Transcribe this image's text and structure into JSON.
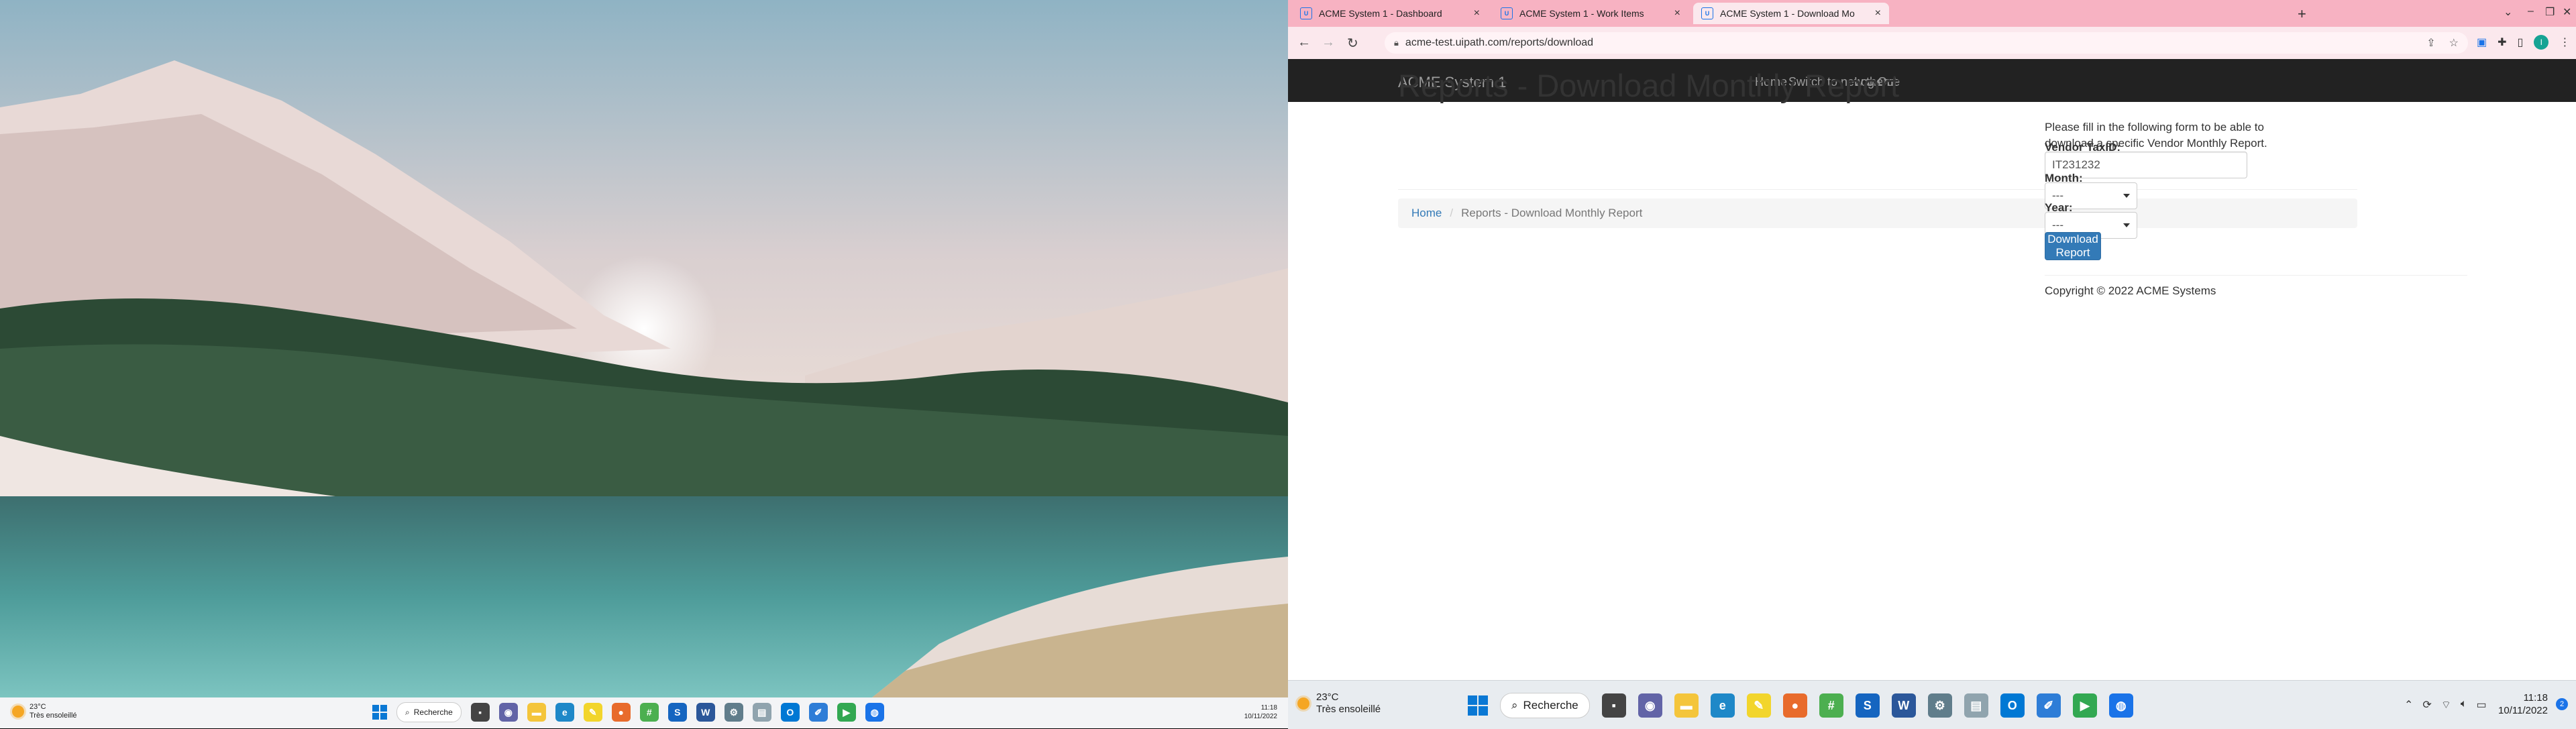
{
  "left_taskbar": {
    "weather_temp": "23°C",
    "weather_desc": "Très ensoleillé",
    "search_label": "Recherche",
    "time": "11:18",
    "date": "10/11/2022"
  },
  "browser": {
    "tabs": [
      {
        "label": "ACME System 1 - Dashboard",
        "active": false
      },
      {
        "label": "ACME System 1 - Work Items",
        "active": false
      },
      {
        "label": "ACME System 1 - Download Mo",
        "active": true
      }
    ],
    "url": "acme-test.uipath.com/reports/download",
    "profile_initial": "I"
  },
  "page": {
    "brand": "ACME System 1",
    "nav": {
      "home": "Home",
      "switch_theme": "Switch to new theme",
      "logout": "Log Out"
    },
    "title": "Reports - Download Monthly Report",
    "breadcrumb": {
      "home": "Home",
      "separator": "/",
      "current": "Reports - Download Monthly Report"
    },
    "intro": "Please fill in the following form to be able to download a specific Vendor Monthly Report.",
    "form": {
      "vendor_label": "Vendor TaxID:",
      "vendor_value": "IT231232",
      "month_label": "Month:",
      "month_value": "---",
      "year_label": "Year:",
      "year_value": "---",
      "submit_label": "Download Report"
    },
    "footer": "Copyright © 2022 ACME Systems"
  },
  "right_taskbar": {
    "weather_temp": "23°C",
    "weather_desc": "Très ensoleillé",
    "search_label": "Recherche",
    "time": "11:18",
    "date": "10/11/2022",
    "notification_count": "2"
  },
  "colors": {
    "tab_strip": "#f7b2c2",
    "navbar": "#222222",
    "primary_button": "#337ab7",
    "link": "#337ab7"
  }
}
